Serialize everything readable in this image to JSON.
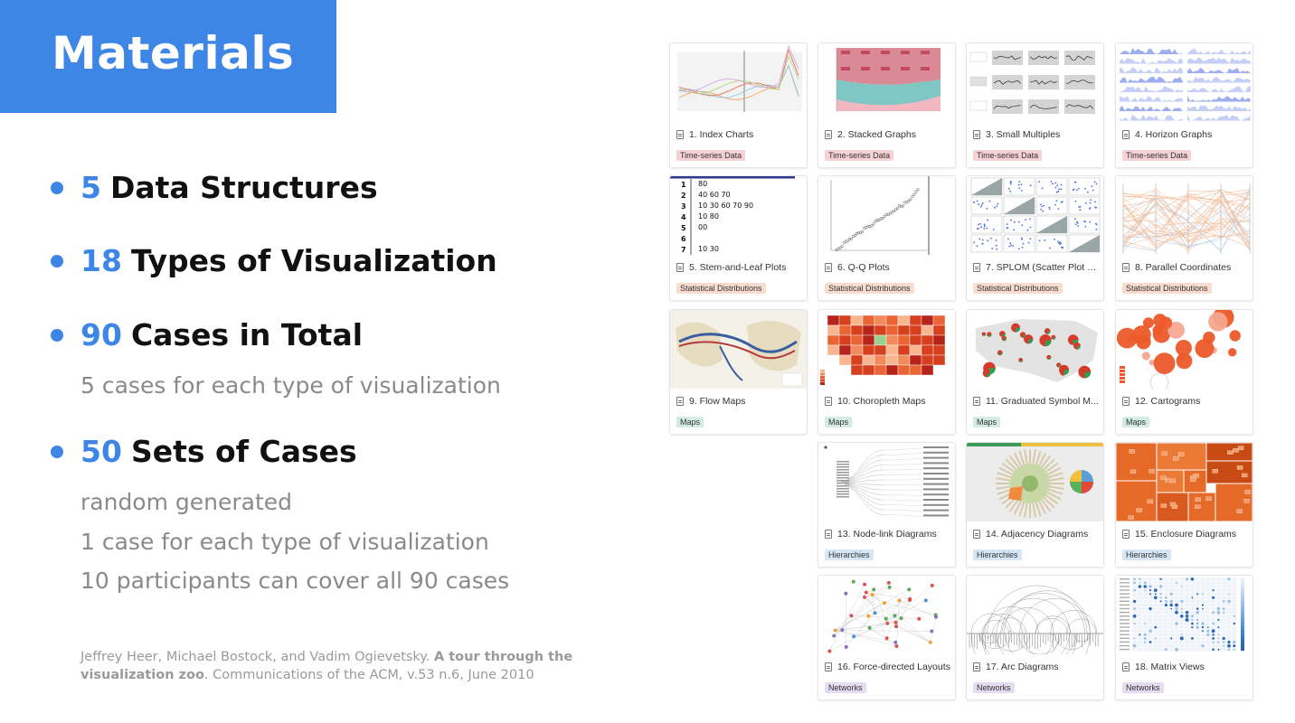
{
  "title": "Materials",
  "colors": {
    "accent": "#3d86e6",
    "muted": "#8a8a8a"
  },
  "bullets": [
    {
      "num": "5",
      "text": "Data Structures"
    },
    {
      "num": "18",
      "text": "Types of Visualization"
    },
    {
      "num": "90",
      "text": "Cases in Total",
      "sub": [
        "5 cases for each type of visualization"
      ]
    },
    {
      "num": "50",
      "text": "Sets of Cases",
      "sub": [
        "random generated",
        "1 case for each type of visualization",
        "10 participants can cover all 90 cases"
      ]
    }
  ],
  "citation": {
    "authors": "Jeffrey Heer, Michael Bostock, and Vadim Ogievetsky.",
    "title": "A tour through the visualization zoo",
    "rest": ". Communications of the ACM, v.53 n.6, June 2010"
  },
  "categories": {
    "time": {
      "label": "Time-series Data",
      "color": "#f6d2d6"
    },
    "stat": {
      "label": "Statistical Distributions",
      "color": "#f9dccd"
    },
    "maps": {
      "label": "Maps",
      "color": "#d3ebe2"
    },
    "hier": {
      "label": "Hierarchies",
      "color": "#d6e6f6"
    },
    "net": {
      "label": "Networks",
      "color": "#e5dbf3"
    }
  },
  "cards": [
    {
      "label": "1. Index Charts",
      "tag": "Time-series Data",
      "thumb": "index-chart"
    },
    {
      "label": "2. Stacked Graphs",
      "tag": "Time-series Data",
      "thumb": "stacked-graph"
    },
    {
      "label": "3. Small Multiples",
      "tag": "Time-series Data",
      "thumb": "small-multiples"
    },
    {
      "label": "4. Horizon Graphs",
      "tag": "Time-series Data",
      "thumb": "horizon-graph"
    },
    {
      "label": "5. Stem-and-Leaf Plots",
      "tag": "Statistical Distributions",
      "thumb": "stem-leaf"
    },
    {
      "label": "6. Q-Q Plots",
      "tag": "Statistical Distributions",
      "thumb": "qq-plot"
    },
    {
      "label": "7. SPLOM (Scatter Plot M...",
      "tag": "Statistical Distributions",
      "thumb": "splom"
    },
    {
      "label": "8. Parallel Coordinates",
      "tag": "Statistical Distributions",
      "thumb": "parallel-coords"
    },
    {
      "label": "9. Flow Maps",
      "tag": "Maps",
      "thumb": "flow-map"
    },
    {
      "label": "10. Choropleth Maps",
      "tag": "Maps",
      "thumb": "choropleth"
    },
    {
      "label": "11. Graduated Symbol M...",
      "tag": "Maps",
      "thumb": "graduated-symbol"
    },
    {
      "label": "12. Cartograms",
      "tag": "Maps",
      "thumb": "cartogram"
    },
    {
      "label": "13. Node-link Diagrams",
      "tag": "Hierarchies",
      "thumb": "node-link"
    },
    {
      "label": "14. Adjacency Diagrams",
      "tag": "Hierarchies",
      "thumb": "adjacency"
    },
    {
      "label": "15. Enclosure Diagrams",
      "tag": "Hierarchies",
      "thumb": "enclosure"
    },
    {
      "label": "16. Force-directed Layouts",
      "tag": "Networks",
      "thumb": "force-directed"
    },
    {
      "label": "17. Arc Diagrams",
      "tag": "Networks",
      "thumb": "arc-diagram"
    },
    {
      "label": "18. Matrix Views",
      "tag": "Networks",
      "thumb": "matrix-view"
    }
  ],
  "stem_leaf_preview": [
    "80",
    "40  60  70",
    "10  30  60  70  90",
    "10  80",
    "00",
    "",
    "10  30"
  ]
}
